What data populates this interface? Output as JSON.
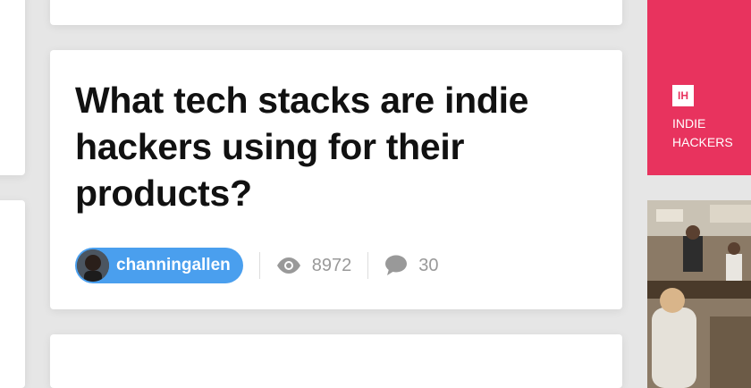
{
  "post": {
    "title": "What tech stacks are indie hackers using for their products?",
    "author": "channingallen",
    "views": "8972",
    "comments": "30"
  },
  "sidebar": {
    "logo_text": "IH",
    "brand_name": "INDIE HACKERS"
  },
  "colors": {
    "accent": "#e8335e",
    "user_pill": "#4a9fee",
    "stat_text": "#999999"
  }
}
